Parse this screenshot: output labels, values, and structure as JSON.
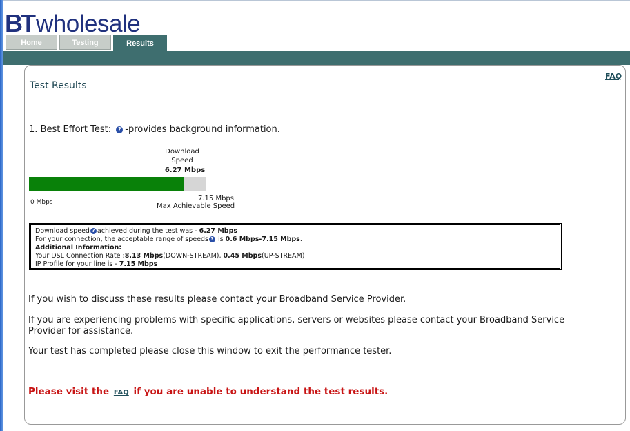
{
  "header": {
    "logo_bt": "BT",
    "logo_word": "wholesale"
  },
  "tabs": [
    {
      "label": "Home"
    },
    {
      "label": "Testing"
    },
    {
      "label": "Results"
    }
  ],
  "faq_link": "FAQ",
  "page_title": "Test Results",
  "best_effort": {
    "label": "1. Best Effort Test:",
    "help_icon": "help-icon",
    "description": "-provides background information."
  },
  "speed_meter": {
    "label_line1": "Download",
    "label_line2": "Speed",
    "value_text": "6.27 Mbps",
    "min_label": "0 Mbps",
    "max_value": "7.15 Mbps",
    "max_label": "Max Achievable Speed",
    "measured": 6.27,
    "max": 7.15,
    "fill_color": "#098109",
    "track_color": "#d6d6d6"
  },
  "info": {
    "line1_pre": "Download speed",
    "line1_mid": "achieved during the test was - ",
    "line1_val": "6.27 Mbps",
    "line2_pre": "For your connection, the acceptable range of speeds",
    "line2_mid": " is ",
    "line2_val": "0.6 Mbps-7.15 Mbps",
    "line2_end": ".",
    "additional_heading": "Additional Information:",
    "line4_pre": "Your DSL Connection Rate :",
    "line4_down": "8.13 Mbps",
    "line4_down_label": "(DOWN-STREAM), ",
    "line4_up": "0.45 Mbps",
    "line4_up_label": "(UP-STREAM)",
    "line5_pre": "IP Profile for your line is - ",
    "line5_val": "7.15 Mbps"
  },
  "paragraphs": {
    "contact": "If you wish to discuss these results please contact your Broadband Service Provider.",
    "problems": "If you are experiencing problems with specific applications, servers or websites please contact your Broadband Service Provider for assistance.",
    "completed": "Your test has completed please close this window to exit the performance tester."
  },
  "faq_notice": {
    "pre": "Please visit the",
    "link": "FAQ",
    "post": "if you are unable to understand the test results."
  },
  "colors": {
    "brand_blue": "#20317e",
    "teal": "#3e6e6f",
    "notice_red": "#c81414"
  }
}
